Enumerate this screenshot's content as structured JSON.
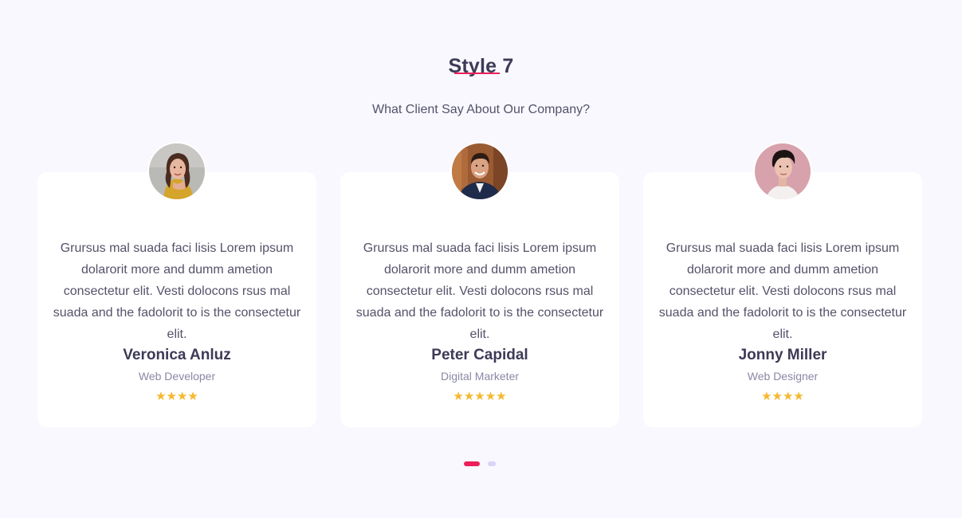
{
  "section": {
    "title": "Style 7",
    "subtitle": "What Client Say About Our Company?",
    "accent_color": "#ec1f58"
  },
  "testimonials": [
    {
      "quote": "Grursus mal suada faci lisis Lorem ipsum dolarorit more and dumm ametion consectetur elit. Vesti dolocons rsus mal suada and the fadolorit to is the consectetur elit.",
      "name": "Veronica Anluz",
      "role": "Web Developer",
      "rating": 4,
      "stars": "★★★★",
      "avatar_icon": "woman-portrait-avatar"
    },
    {
      "quote": "Grursus mal suada faci lisis Lorem ipsum dolarorit more and dumm ametion consectetur elit. Vesti dolocons rsus mal suada and the fadolorit to is the consectetur elit.",
      "name": "Peter Capidal",
      "role": "Digital Marketer",
      "rating": 5,
      "stars": "★★★★★",
      "avatar_icon": "man-portrait-avatar"
    },
    {
      "quote": "Grursus mal suada faci lisis Lorem ipsum dolarorit more and dumm ametion consectetur elit. Vesti dolocons rsus mal suada and the fadolorit to is the consectetur elit.",
      "name": "Jonny Miller",
      "role": "Web Designer",
      "rating": 4,
      "stars": "★★★★",
      "avatar_icon": "man-portrait-avatar"
    }
  ],
  "pagination": {
    "active_index": 0,
    "pages": 2,
    "active_color": "#ec1f58",
    "inactive_color": "#d9d3f6"
  },
  "colors": {
    "background": "#f8f8fe",
    "card": "#ffffff",
    "heading": "#3d3a57",
    "text": "#54526a",
    "muted": "#8a88a6",
    "star": "#f5b82e"
  }
}
